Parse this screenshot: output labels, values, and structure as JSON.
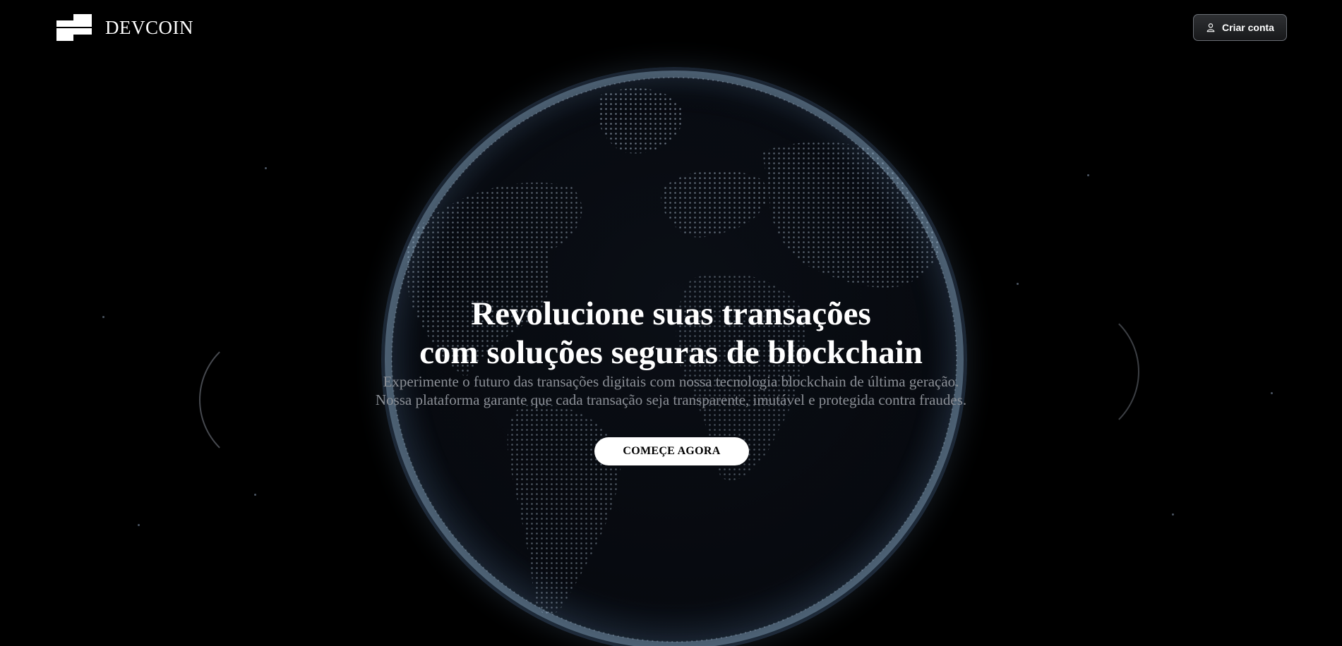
{
  "header": {
    "brand_name": "DEVCOIN",
    "signup_button": "Criar conta"
  },
  "hero": {
    "title_line1": "Revolucione suas transações",
    "title_line2": "com soluções seguras de blockchain",
    "description_line1": "Experimente o futuro das transações digitais com nossa tecnologia blockchain de última geração.",
    "description_line2": "Nossa plataforma garante que cada transação seja transparente, imutável e protegida contra fraudes.",
    "cta_button": "COMEÇE AGORA"
  },
  "icons": {
    "logo": "devcoin-logo-icon",
    "signup": "user-icon",
    "background": "digital-globe"
  },
  "colors": {
    "background": "#000000",
    "text_primary": "#ffffff",
    "text_secondary": "#8b8f96",
    "cta_background": "#ffffff",
    "signup_border": "#6a6e75"
  }
}
